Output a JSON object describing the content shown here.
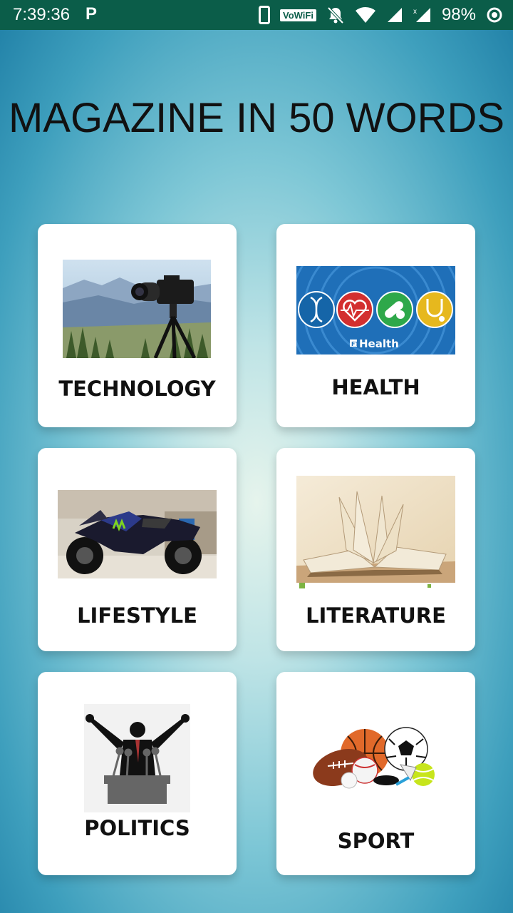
{
  "status_bar": {
    "time": "7:39:36",
    "p_label": "P",
    "vowifi_label": "VoWiFi",
    "battery": "98%"
  },
  "app": {
    "title": "MAGAZINE IN 50 WORDS"
  },
  "categories": [
    {
      "label": "TECHNOLOGY",
      "icon": "camera-tripod-image"
    },
    {
      "label": "HEALTH",
      "icon": "health-icons-image",
      "image_text": "Health",
      "image_badge": "FT"
    },
    {
      "label": "LIFESTYLE",
      "icon": "motorcycle-image"
    },
    {
      "label": "LITERATURE",
      "icon": "open-book-image"
    },
    {
      "label": "POLITICS",
      "icon": "politician-podium-image"
    },
    {
      "label": "SPORT",
      "icon": "sports-balls-image"
    }
  ],
  "colors": {
    "status_bar": "#0b5d49",
    "health_bg": "#1f6fb8",
    "health_dna": "#1565a8",
    "health_heart": "#d32f2f",
    "health_pill": "#2ea84a",
    "health_steth": "#e6b81e"
  }
}
